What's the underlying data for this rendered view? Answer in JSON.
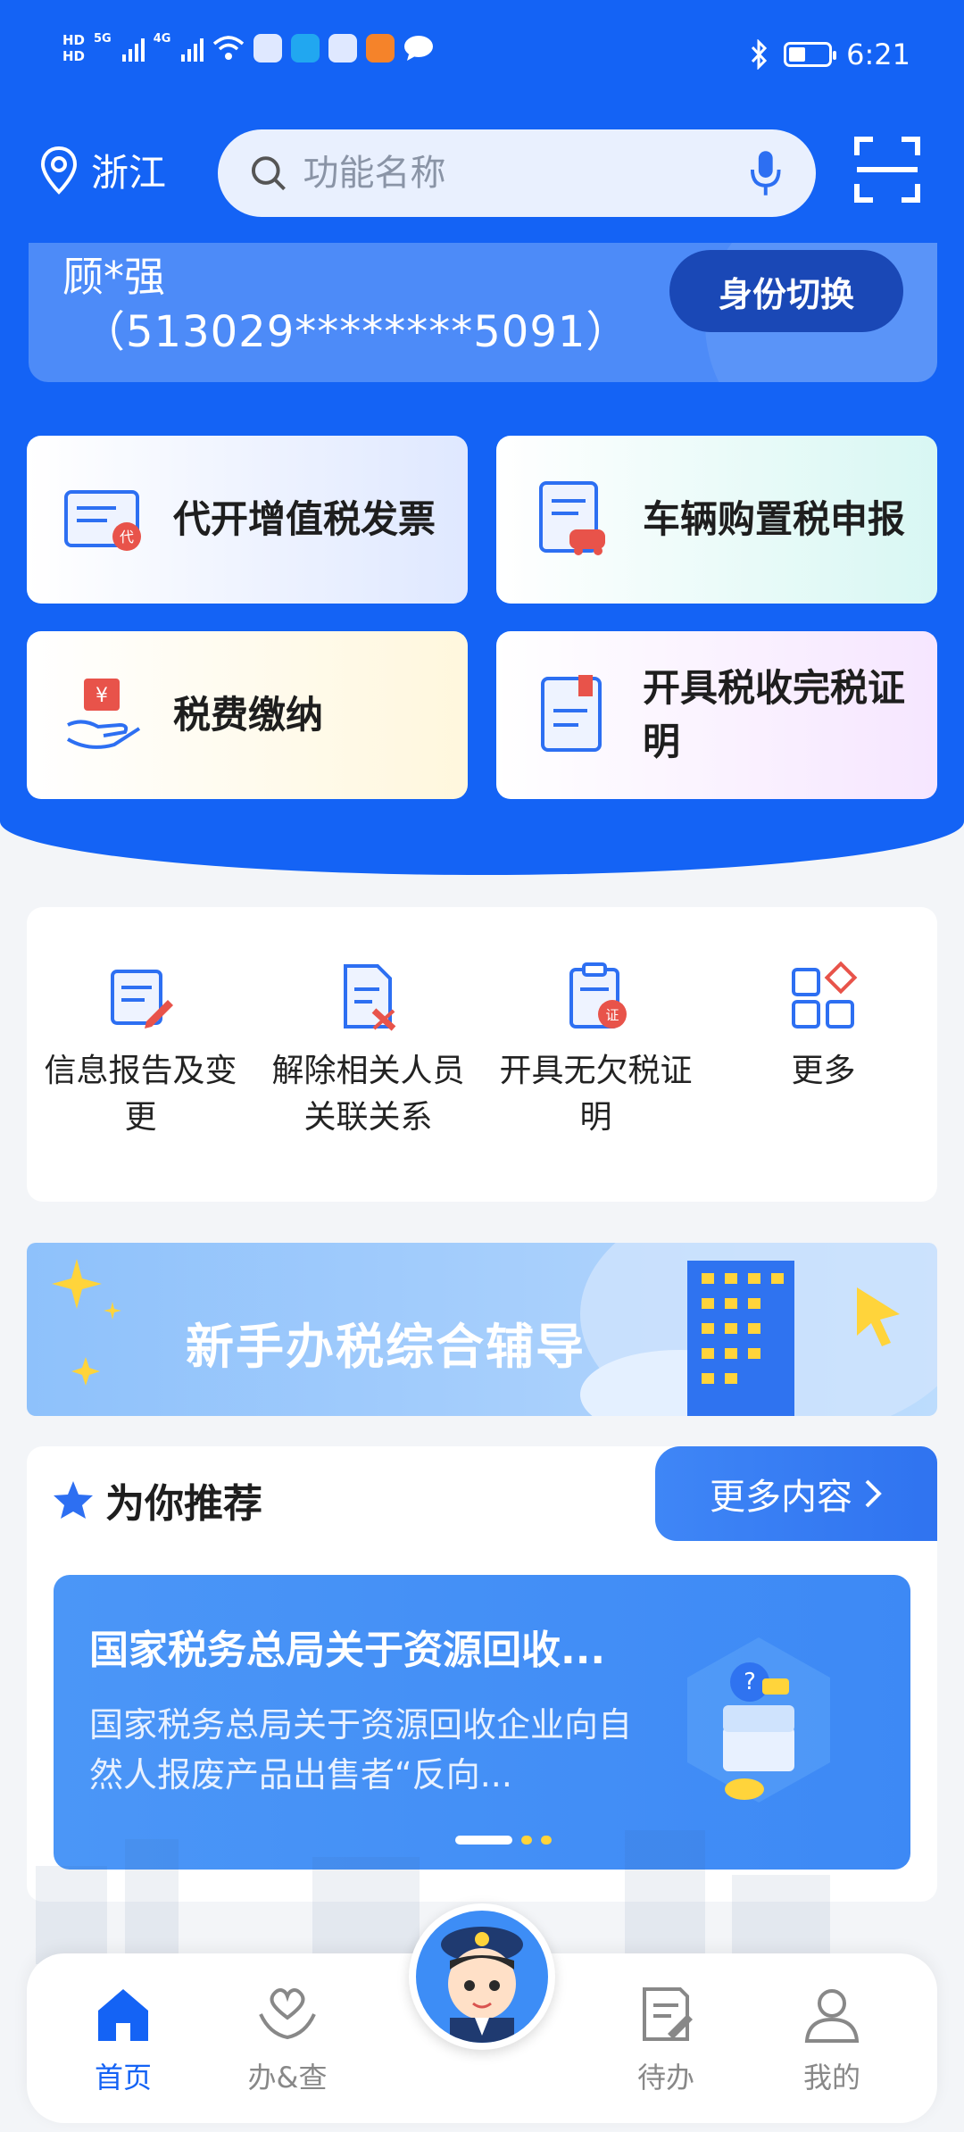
{
  "status_bar": {
    "hd1": "HD",
    "hd2": "HD",
    "net1": "5G",
    "net2": "4G",
    "time": "6:21"
  },
  "header": {
    "location": "浙江",
    "search_placeholder": "功能名称"
  },
  "identity": {
    "name": "顾*强",
    "id_number": "（513029********5091）",
    "switch_label": "身份切换"
  },
  "quick_tiles": [
    {
      "label": "代开增值税发票",
      "icon": "invoice-icon"
    },
    {
      "label": "车辆购置税申报",
      "icon": "vehicle-tax-icon"
    },
    {
      "label": "税费缴纳",
      "icon": "payment-icon"
    },
    {
      "label": "开具税收完税证明",
      "icon": "certificate-icon"
    }
  ],
  "services": [
    {
      "label": "信息报告及变更",
      "icon": "report-edit-icon"
    },
    {
      "label": "解除相关人员关联关系",
      "icon": "unlink-icon"
    },
    {
      "label": "开具无欠税证明",
      "icon": "no-arrears-icon"
    },
    {
      "label": "更多",
      "icon": "more-grid-icon"
    }
  ],
  "banner": {
    "text": "新手办税综合辅导"
  },
  "recommend": {
    "title": "为你推荐",
    "more_label": "更多内容",
    "card": {
      "headline": "国家税务总局关于资源回收...",
      "description": "国家税务总局关于资源回收企业向自然人报废产品出售者“反向..."
    }
  },
  "bottom_nav": [
    {
      "label": "首页",
      "icon": "home-icon",
      "active": true
    },
    {
      "label": "办&查",
      "icon": "heart-hands-icon",
      "active": false
    },
    {
      "label": "待办",
      "icon": "todo-icon",
      "active": false
    },
    {
      "label": "我的",
      "icon": "user-icon",
      "active": false
    }
  ],
  "colors": {
    "primary": "#1463f5",
    "id_switch": "#1a48b6",
    "accent_red": "#e8534a"
  }
}
